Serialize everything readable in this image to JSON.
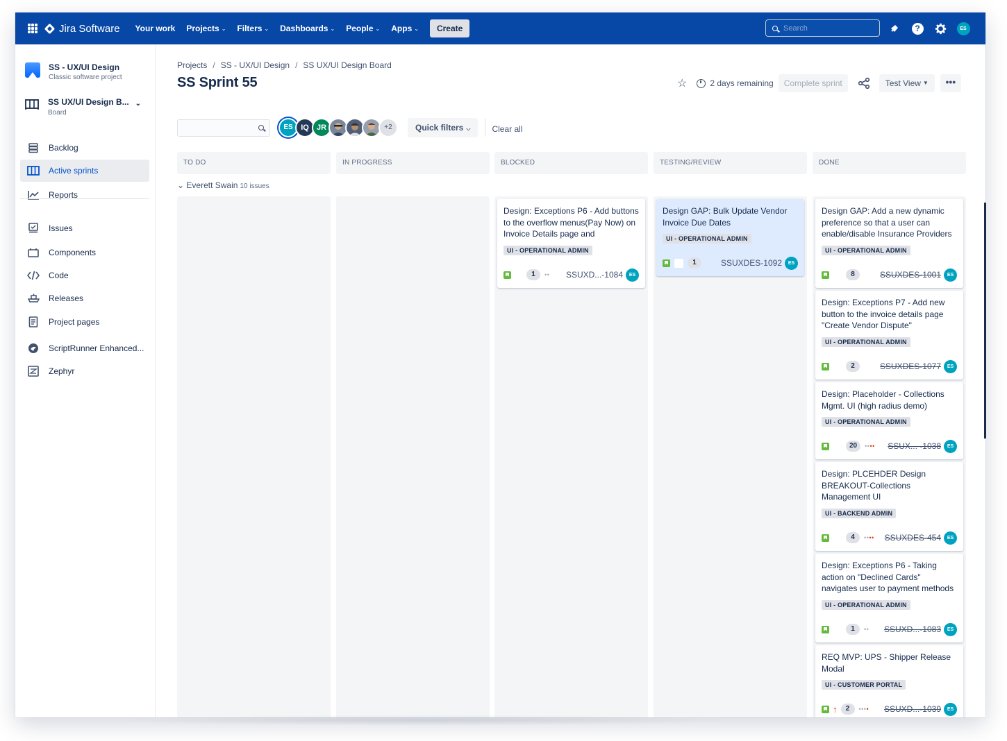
{
  "topnav": {
    "product_name": "Jira Software",
    "items": [
      {
        "label": "Your work",
        "has_dropdown": false
      },
      {
        "label": "Projects",
        "has_dropdown": true
      },
      {
        "label": "Filters",
        "has_dropdown": true
      },
      {
        "label": "Dashboards",
        "has_dropdown": true
      },
      {
        "label": "People",
        "has_dropdown": true
      },
      {
        "label": "Apps",
        "has_dropdown": true
      }
    ],
    "create_label": "Create",
    "search_placeholder": "Search",
    "user_initials": "ES"
  },
  "sidebar": {
    "project_name": "SS - UX/UI Design",
    "project_type": "Classic software project",
    "board_name": "SS UX/UI Design B...",
    "board_type": "Board",
    "items": [
      {
        "label": "Backlog",
        "icon": "backlog-icon",
        "active": false
      },
      {
        "label": "Active sprints",
        "icon": "board-columns-icon",
        "active": true
      },
      {
        "label": "Reports",
        "icon": "chart-line-icon",
        "active": false
      },
      {
        "label": "Issues",
        "icon": "issues-icon",
        "active": false
      },
      {
        "label": "Components",
        "icon": "components-icon",
        "active": false
      },
      {
        "label": "Code",
        "icon": "code-icon",
        "active": false
      },
      {
        "label": "Releases",
        "icon": "ship-icon",
        "active": false
      },
      {
        "label": "Project pages",
        "icon": "page-icon",
        "active": false
      },
      {
        "label": "ScriptRunner Enhanced...",
        "icon": "scriptrunner-icon",
        "active": false
      },
      {
        "label": "Zephyr",
        "icon": "zephyr-icon",
        "active": false
      }
    ]
  },
  "main": {
    "breadcrumb": [
      "Projects",
      "SS - UX/UI Design",
      "SS UX/UI Design Board"
    ],
    "title": "SS Sprint 55",
    "days_remaining": "2 days remaining",
    "complete_sprint_label": "Complete sprint",
    "view_label": "Test View",
    "more_label": "•••",
    "filters": {
      "avatars": [
        {
          "initials": "ES",
          "color": "#00a3bf"
        },
        {
          "initials": "IQ",
          "color": "#253858"
        },
        {
          "initials": "JR",
          "color": "#00875a"
        }
      ],
      "more_count": "+2",
      "quick_filters_label": "Quick filters",
      "clear_all_label": "Clear all"
    },
    "columns": [
      "TO DO",
      "IN PROGRESS",
      "BLOCKED",
      "TESTING/REVIEW",
      "DONE"
    ],
    "swimlane": {
      "name": "Everett Swain",
      "count": "10 issues"
    },
    "cards": {
      "blocked": [
        {
          "summary": "Design: Exceptions P6 - Add buttons to the overflow menus(Pay Now) on Invoice Details page and",
          "epic": "UI - OPERATIONAL ADMIN",
          "estimate": "1",
          "key": "SSUXD...-1084",
          "assignee": "ES"
        }
      ],
      "testing": [
        {
          "summary": "Design GAP: Bulk Update Vendor Invoice Due Dates",
          "epic": "UI - OPERATIONAL ADMIN",
          "estimate": "1",
          "key": "SSUXDES-1092",
          "assignee": "ES"
        }
      ],
      "done": [
        {
          "summary": "Design GAP: Add a new dynamic preference so that a user can enable/disable Insurance Providers",
          "epic": "UI - OPERATIONAL ADMIN",
          "estimate": "8",
          "key": "SSUXDES-1001",
          "assignee": "ES"
        },
        {
          "summary": "Design: Exceptions P7 - Add new button to the invoice details page \"Create Vendor Dispute\"",
          "epic": "UI - OPERATIONAL ADMIN",
          "estimate": "2",
          "key": "SSUXDES-1077",
          "assignee": "ES"
        },
        {
          "summary": "Design: Placeholder - Collections Mgmt. UI (high radius demo)",
          "epic": "UI - OPERATIONAL ADMIN",
          "estimate": "20",
          "key": "SSUX... -1038",
          "assignee": "ES"
        },
        {
          "summary": "Design: PLCEHDER Design BREAKOUT-Collections Management UI",
          "epic": "UI - BACKEND ADMIN",
          "estimate": "4",
          "key": "SSUXDES-454",
          "assignee": "ES"
        },
        {
          "summary": "Design: Exceptions P6 - Taking action on \"Declined Cards\" navigates user to payment methods",
          "epic": "UI - OPERATIONAL ADMIN",
          "estimate": "1",
          "key": "SSUXD...-1083",
          "assignee": "ES"
        },
        {
          "summary": "REQ MVP: UPS - Shipper Release Modal",
          "epic": "UI - CUSTOMER PORTAL",
          "estimate": "2",
          "key": "SSUXD...-1039",
          "assignee": "ES"
        }
      ]
    }
  },
  "colors": {
    "nav_bg": "#0747a6",
    "active": "#0052cc",
    "story": "#63ba3c",
    "avatar": "#00a3bf"
  }
}
